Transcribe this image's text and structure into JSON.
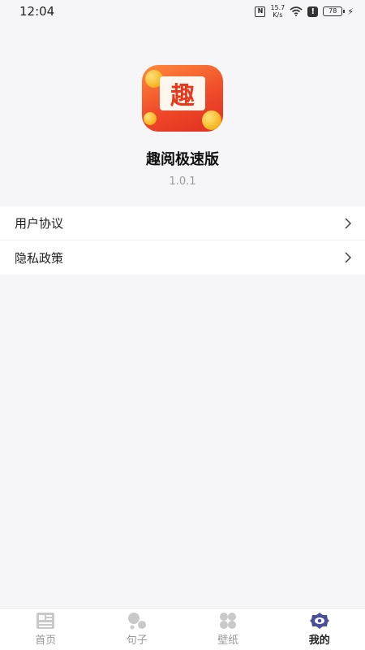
{
  "status_bar": {
    "time": "12:04",
    "speed_value": "15.7",
    "speed_unit": "K/s",
    "battery": "78"
  },
  "app": {
    "logo_text": "趣",
    "name": "趣阅极速版",
    "version": "1.0.1"
  },
  "menu": {
    "items": [
      {
        "label": "用户协议",
        "icon": "chevron-right-icon"
      },
      {
        "label": "隐私政策",
        "icon": "chevron-right-icon"
      }
    ]
  },
  "bottom_nav": {
    "items": [
      {
        "label": "首页",
        "icon": "news-icon",
        "active": false
      },
      {
        "label": "句子",
        "icon": "bubbles-icon",
        "active": false
      },
      {
        "label": "壁纸",
        "icon": "grid-icon",
        "active": false
      },
      {
        "label": "我的",
        "icon": "flower-eye-icon",
        "active": true
      }
    ],
    "active_color": "#4b4f9a",
    "inactive_color": "#c9c9c9"
  },
  "colors": {
    "logo_gradient_start": "#ff8a3a",
    "logo_gradient_end": "#e02e20",
    "background": "#f6f6f8"
  }
}
